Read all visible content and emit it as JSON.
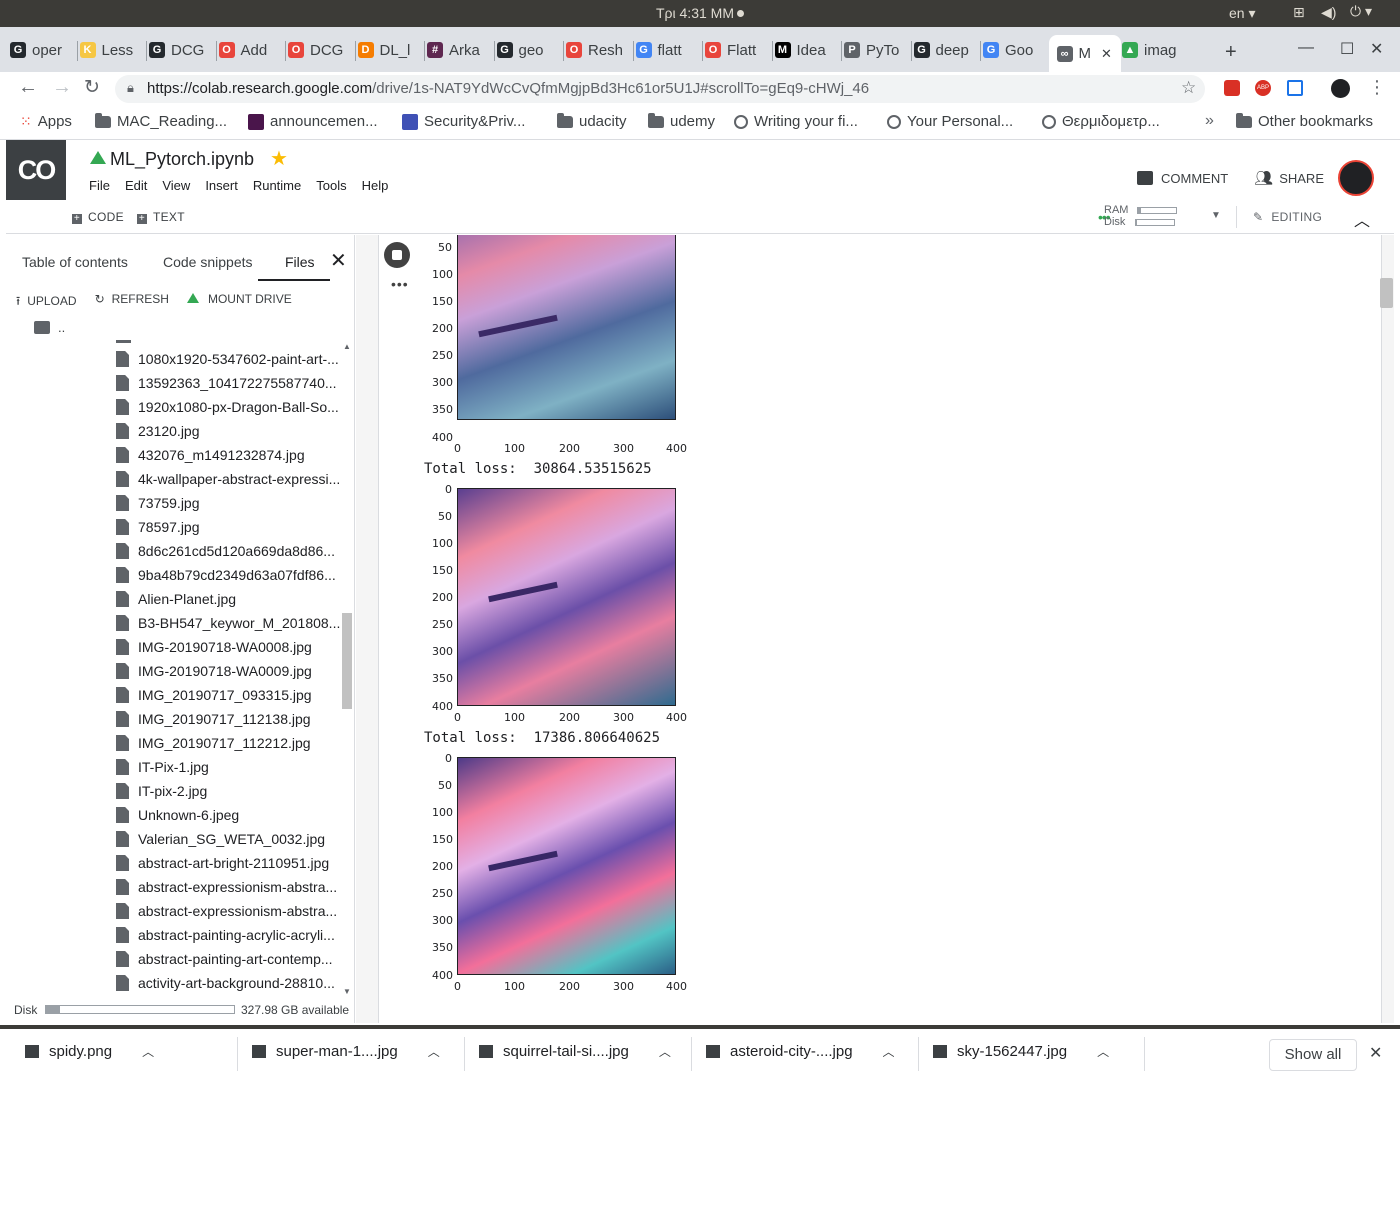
{
  "system": {
    "time": "Τρι 4:31 ΜΜ",
    "lang": "en"
  },
  "browser": {
    "tabs": [
      {
        "label": "oper",
        "color": "#24292e",
        "glyph": "G"
      },
      {
        "label": "Less",
        "color": "#f6c744",
        "glyph": "K"
      },
      {
        "label": "DCG",
        "color": "#24292e",
        "glyph": "G"
      },
      {
        "label": "Add",
        "color": "#e8453c",
        "glyph": "O"
      },
      {
        "label": "DCG",
        "color": "#e8453c",
        "glyph": "O"
      },
      {
        "label": "DL_l",
        "color": "#f57c00",
        "glyph": "D"
      },
      {
        "label": "Arka",
        "color": "#5e2750",
        "glyph": "#"
      },
      {
        "label": "geo",
        "color": "#24292e",
        "glyph": "G"
      },
      {
        "label": "Resh",
        "color": "#e8453c",
        "glyph": "O"
      },
      {
        "label": "flatt",
        "color": "#4285f4",
        "glyph": "G"
      },
      {
        "label": "Flatt",
        "color": "#e8453c",
        "glyph": "O"
      },
      {
        "label": "Idea",
        "color": "#000000",
        "glyph": "M"
      },
      {
        "label": "PyTo",
        "color": "#5f6368",
        "glyph": "P"
      },
      {
        "label": "deep",
        "color": "#24292e",
        "glyph": "G"
      },
      {
        "label": "Goo",
        "color": "#4285f4",
        "glyph": "G"
      },
      {
        "label": "M",
        "color": "#5f6368",
        "glyph": "∞"
      },
      {
        "label": "imag",
        "color": "#34a853",
        "glyph": "▲"
      }
    ],
    "url_domain": "https://colab.research.google.com",
    "url_path": "/drive/1s-NAT9YdWcCvQfmMgjpBd3Hc61or5U1J#scrollTo=gEq9-cHWj_46",
    "bookmarks": [
      "Apps",
      "MAC_Reading...",
      "announcemen...",
      "Security&Priv...",
      "udacity",
      "udemy",
      "Writing your fi...",
      "Your Personal...",
      "Θερμιδομετρ..."
    ],
    "other_bookmarks": "Other bookmarks"
  },
  "colab": {
    "logo": "CO",
    "notebook_title": "ML_Pytorch.ipynb",
    "menu": [
      "File",
      "Edit",
      "View",
      "Insert",
      "Runtime",
      "Tools",
      "Help"
    ],
    "comment_label": "COMMENT",
    "share_label": "SHARE",
    "code_label": "CODE",
    "text_label": "TEXT",
    "ram_label": "RAM",
    "disk_label": "Disk",
    "editing_label": "EDITING"
  },
  "sidebar": {
    "tabs": [
      "Table of contents",
      "Code snippets",
      "Files"
    ],
    "actions": [
      "UPLOAD",
      "REFRESH",
      "MOUNT DRIVE"
    ],
    "updir": "..",
    "files": [
      "1080x1920-5347602-paint-art-...",
      "13592363_104172275587740...",
      "1920x1080-px-Dragon-Ball-So...",
      "23120.jpg",
      "432076_m1491232874.jpg",
      "4k-wallpaper-abstract-expressi...",
      "73759.jpg",
      "78597.jpg",
      "8d6c261cd5d120a669da8d86...",
      "9ba48b79cd2349d63a07fdf86...",
      "Alien-Planet.jpg",
      "B3-BH547_keywor_M_201808...",
      "IMG-20190718-WA0008.jpg",
      "IMG-20190718-WA0009.jpg",
      "IMG_20190717_093315.jpg",
      "IMG_20190717_112138.jpg",
      "IMG_20190717_112212.jpg",
      "IT-Pix-1.jpg",
      "IT-pix-2.jpg",
      "Unknown-6.jpeg",
      "Valerian_SG_WETA_0032.jpg",
      "abstract-art-bright-2110951.jpg",
      "abstract-expressionism-abstra...",
      "abstract-expressionism-abstra...",
      "abstract-painting-acrylic-acryli...",
      "abstract-painting-art-contemp...",
      "activity-art-background-28810..."
    ],
    "disk_label": "Disk",
    "disk_available": "327.98 GB available"
  },
  "output": {
    "loss_1": "Total loss:  30864.53515625",
    "loss_2": "Total loss:  17386.806640625",
    "y_ticks": [
      "0",
      "50",
      "100",
      "150",
      "200",
      "250",
      "300",
      "350",
      "400"
    ],
    "x_ticks": [
      "0",
      "100",
      "200",
      "300",
      "400"
    ]
  },
  "downloads": {
    "items": [
      "spidy.png",
      "super-man-1....jpg",
      "squirrel-tail-si....jpg",
      "asteroid-city-....jpg",
      "sky-1562447.jpg"
    ],
    "show_all": "Show all"
  }
}
